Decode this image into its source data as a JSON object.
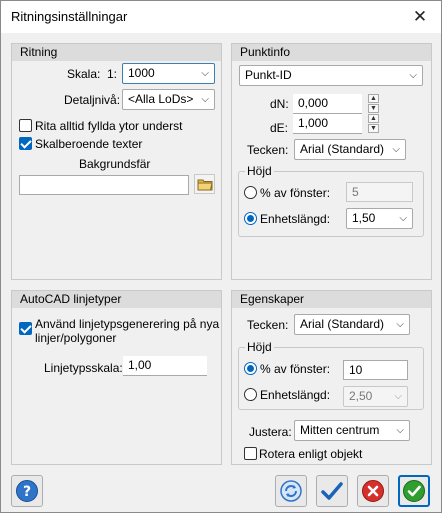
{
  "window": {
    "title": "Ritningsinställningar"
  },
  "ritning": {
    "header": "Ritning",
    "scale_label": "Skala:",
    "scale_prefix": "1:",
    "scale_value": "1000",
    "detail_label": "Detaljnivå:",
    "detail_value": "<Alla LoDs>",
    "fill_bottom_label": "Rita alltid fyllda ytor underst",
    "fill_bottom_checked": false,
    "scaled_text_label": "Skalberoende texter",
    "scaled_text_checked": true,
    "background_label": "Bakgrundsfär",
    "background_value": ""
  },
  "punktinfo": {
    "header": "Punktinfo",
    "type_value": "Punkt-ID",
    "dn_label": "dN:",
    "dn_value": "0,000",
    "de_label": "dE:",
    "de_value": "1,000",
    "font_label": "Tecken:",
    "font_value": "Arial (Standard)",
    "height_group": "Höjd",
    "pct_label": "% av fönster:",
    "pct_value": "5",
    "pct_selected": false,
    "unit_label": "Enhetslängd:",
    "unit_value": "1,50",
    "unit_selected": true
  },
  "autocad": {
    "header": "AutoCAD linjetyper",
    "generate_label": "Använd linjetypsgenerering på nya linjer/polygoner",
    "generate_line1": "Använd linjetypsgenerering på nya",
    "generate_line2": "linjer/polygoner",
    "generate_checked": true,
    "scale_label": "Linjetypsskala:",
    "scale_value": "1,00"
  },
  "egenskaper": {
    "header": "Egenskaper",
    "font_label": "Tecken:",
    "font_value": "Arial (Standard)",
    "height_group": "Höjd",
    "pct_label": "% av fönster:",
    "pct_value": "10",
    "pct_selected": true,
    "unit_label": "Enhetslängd:",
    "unit_value": "2,50",
    "unit_selected": false,
    "justify_label": "Justera:",
    "justify_value": "Mitten centrum",
    "rotate_label": "Rotera enligt objekt",
    "rotate_checked": false
  },
  "buttons": {
    "help_icon": "help-icon",
    "refresh_icon": "refresh-icon",
    "apply_icon": "checkmark-icon",
    "cancel_icon": "cancel-icon",
    "ok_icon": "ok-icon"
  },
  "colors": {
    "accent": "#0067c0",
    "cancel_red": "#d7302b",
    "ok_green": "#2f9e2f",
    "panel_header": "#dcdcdc"
  }
}
